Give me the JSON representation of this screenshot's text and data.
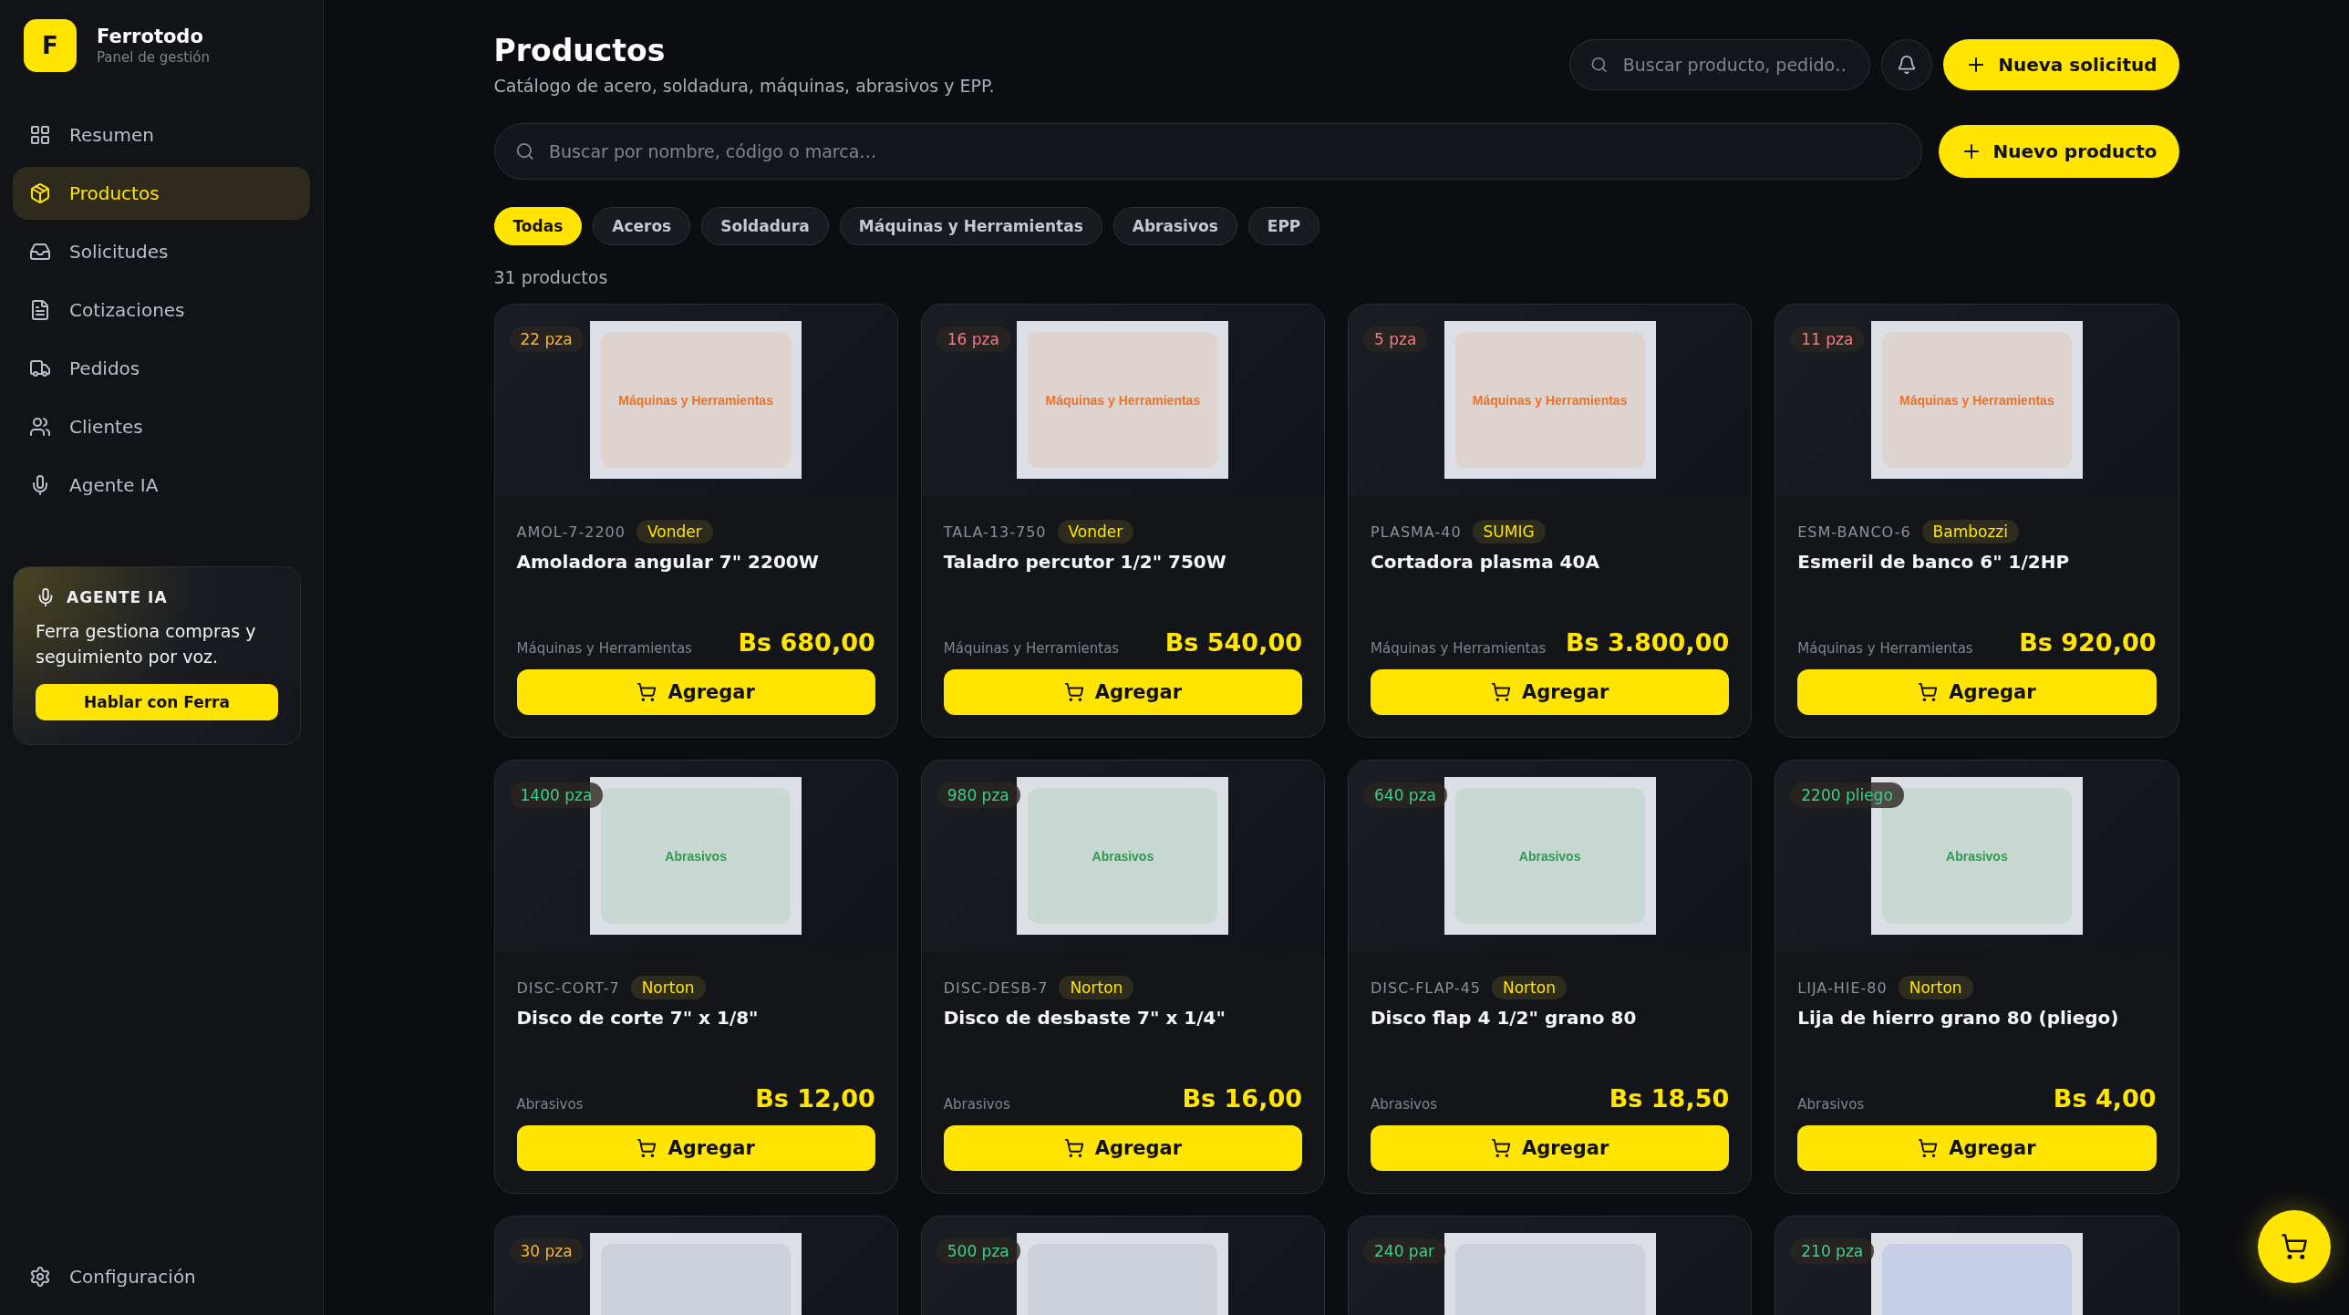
{
  "brand": {
    "logo_letter": "F",
    "name": "Ferrotodo",
    "subtitle": "Panel de gestión"
  },
  "nav": [
    {
      "label": "Resumen",
      "kind": "grid",
      "selected": false
    },
    {
      "label": "Productos",
      "kind": "package",
      "selected": true
    },
    {
      "label": "Solicitudes",
      "kind": "inbox",
      "selected": false
    },
    {
      "label": "Cotizaciones",
      "kind": "file",
      "selected": false
    },
    {
      "label": "Pedidos",
      "kind": "truck",
      "selected": false
    },
    {
      "label": "Clientes",
      "kind": "users",
      "selected": false
    },
    {
      "label": "Agente IA",
      "kind": "mic",
      "selected": false
    }
  ],
  "agent_card": {
    "title": "AGENTE IA",
    "text": "Ferra gestiona compras y seguimiento por voz.",
    "button": "Hablar con Ferra"
  },
  "settings": {
    "label": "Configuración"
  },
  "header": {
    "title": "Productos",
    "subtitle": "Catálogo de acero, soldadura, máquinas, abrasivos y EPP.",
    "search_placeholder": "Buscar producto, pedido…",
    "new_button": "Nueva solicitud"
  },
  "catalog_search": {
    "placeholder": "Buscar por nombre, código o marca…"
  },
  "new_product_button": "Nuevo producto",
  "filters": [
    {
      "label": "Todas",
      "selected": true
    },
    {
      "label": "Aceros",
      "selected": false
    },
    {
      "label": "Soldadura",
      "selected": false
    },
    {
      "label": "Máquinas y Herramientas",
      "selected": false
    },
    {
      "label": "Abrasivos",
      "selected": false
    },
    {
      "label": "EPP",
      "selected": false
    }
  ],
  "count": "31 productos",
  "products": [
    {
      "stock": "22 pza",
      "color": "#f2b53a",
      "image": {
        "label": "Máquinas y Herramientas",
        "color": "#ddd3cf"
      },
      "code": "AMOL-7-2200",
      "brand": "Vonder",
      "name": "Amoladora angular 7\" 2200W",
      "category": "Máquinas y Herramientas",
      "price": "Bs 680,00",
      "add_button": "Agregar"
    },
    {
      "stock": "16 pza",
      "color": "#f07a8a",
      "image": {
        "label": "Máquinas y Herramientas",
        "color": "#ddd3cf"
      },
      "code": "TALA-13-750",
      "brand": "Vonder",
      "name": "Taladro percutor 1/2\" 750W",
      "category": "Máquinas y Herramientas",
      "price": "Bs 540,00",
      "add_button": "Agregar"
    },
    {
      "stock": "5 pza",
      "color": "#f07a8a",
      "image": {
        "label": "Máquinas y Herramientas",
        "color": "#ddd3cf"
      },
      "code": "PLASMA-40",
      "brand": "SUMIG",
      "name": "Cortadora plasma 40A",
      "category": "Máquinas y Herramientas",
      "price": "Bs 3.800,00",
      "add_button": "Agregar"
    },
    {
      "stock": "11 pza",
      "color": "#f07a8a",
      "image": {
        "label": "Máquinas y Herramientas",
        "color": "#ddd3cf"
      },
      "code": "ESM-BANCO-6",
      "brand": "Bambozzi",
      "name": "Esmeril de banco 6\" 1/2HP",
      "category": "Máquinas y Herramientas",
      "price": "Bs 920,00",
      "add_button": "Agregar"
    },
    {
      "stock": "1400 pza",
      "color": "#3ecf8e",
      "image": {
        "label": "Abrasivos",
        "color": "#c8d8d2"
      },
      "code": "DISC-CORT-7",
      "brand": "Norton",
      "name": "Disco de corte 7\" x 1/8\"",
      "category": "Abrasivos",
      "price": "Bs 12,00",
      "add_button": "Agregar"
    },
    {
      "stock": "980 pza",
      "color": "#3ecf8e",
      "image": {
        "label": "Abrasivos",
        "color": "#c8d8d2"
      },
      "code": "DISC-DESB-7",
      "brand": "Norton",
      "name": "Disco de desbaste 7\" x 1/4\"",
      "category": "Abrasivos",
      "price": "Bs 16,00",
      "add_button": "Agregar"
    },
    {
      "stock": "640 pza",
      "color": "#3ecf8e",
      "image": {
        "label": "Abrasivos",
        "color": "#c8d8d2"
      },
      "code": "DISC-FLAP-45",
      "brand": "Norton",
      "name": "Disco flap 4 1/2\" grano 80",
      "category": "Abrasivos",
      "price": "Bs 18,50",
      "add_button": "Agregar"
    },
    {
      "stock": "2200 pliego",
      "color": "#3ecf8e",
      "image": {
        "label": "Abrasivos",
        "color": "#c8d8d2"
      },
      "code": "LIJA-HIE-80",
      "brand": "Norton",
      "name": "Lija de hierro grano 80 (pliego)",
      "category": "Abrasivos",
      "price": "Bs 4,00",
      "add_button": "Agregar"
    },
    {
      "stock": "30 pza",
      "color": "#f2b53a",
      "image": {
        "color": "#ccd0d8"
      }
    },
    {
      "stock": "500 pza",
      "color": "#3ecf8e",
      "image": {
        "color": "#ccd0d8"
      }
    },
    {
      "stock": "240 par",
      "color": "#3ecf8e",
      "image": {
        "color": "#ccd0d8"
      }
    },
    {
      "stock": "210 pza",
      "color": "#3ecf8e",
      "image": {
        "color": "#c8cde6"
      }
    }
  ]
}
